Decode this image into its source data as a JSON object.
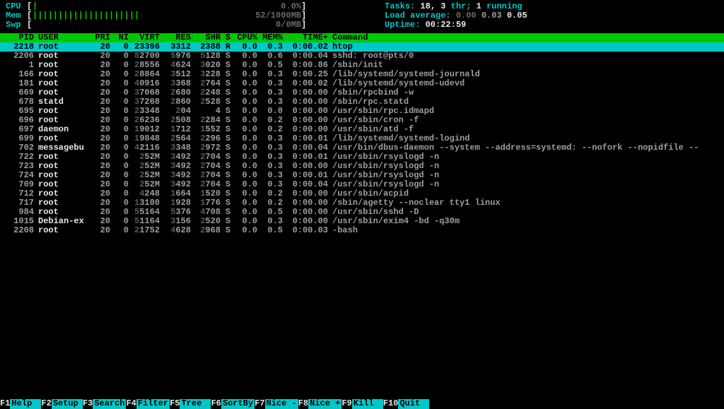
{
  "meters": {
    "cpu": {
      "label": "CPU",
      "bar_chars": "|",
      "value": "0.0%"
    },
    "mem": {
      "label": "Mem",
      "bar_chars": "|||||||||||||||||||||",
      "value": "52/1000MB"
    },
    "swp": {
      "label": "Swp",
      "bar_chars": "",
      "value": "0/0MB"
    }
  },
  "stats": {
    "tasks_label": "Tasks: ",
    "tasks_value": "18, 3",
    "tasks_suffix": " thr; ",
    "running_value": "1",
    "running_suffix": " running",
    "load_label": "Load average: ",
    "load_1": "0.00",
    "load_2": "0.03",
    "load_3": "0.05",
    "uptime_label": "Uptime: ",
    "uptime_value": "00:22:59"
  },
  "columns": {
    "pid": "PID",
    "user": "USER",
    "pri": "PRI",
    "ni": "NI",
    "virt": "VIRT",
    "res": "RES",
    "shr": "SHR",
    "s": "S",
    "cpu": "CPU%",
    "mem": "MEM%",
    "time": "TIME+",
    "cmd": "Command"
  },
  "processes": [
    {
      "pid": "2218",
      "user": "root",
      "pri": "20",
      "ni": "0",
      "virt": "23396",
      "res": "3312",
      "shr": "2388",
      "s": "R",
      "cpu": "0.0",
      "mem": "0.3",
      "time": "0:00.02",
      "cmd": "htop",
      "hl": true
    },
    {
      "pid": "2206",
      "user": "root",
      "pri": "20",
      "ni": "0",
      "virt": "82700",
      "res": "5976",
      "shr": "5128",
      "s": "S",
      "cpu": "0.0",
      "mem": "0.6",
      "time": "0:00.04",
      "cmd": "sshd: root@pts/0"
    },
    {
      "pid": "1",
      "user": "root",
      "pri": "20",
      "ni": "0",
      "virt": "28556",
      "res": "4624",
      "shr": "3020",
      "s": "S",
      "cpu": "0.0",
      "mem": "0.5",
      "time": "0:00.86",
      "cmd": "/sbin/init"
    },
    {
      "pid": "166",
      "user": "root",
      "pri": "20",
      "ni": "0",
      "virt": "28864",
      "res": "3512",
      "shr": "3228",
      "s": "S",
      "cpu": "0.0",
      "mem": "0.3",
      "time": "0:00.25",
      "cmd": "/lib/systemd/systemd-journald"
    },
    {
      "pid": "181",
      "user": "root",
      "pri": "20",
      "ni": "0",
      "virt": "40916",
      "res": "3368",
      "shr": "2764",
      "s": "S",
      "cpu": "0.0",
      "mem": "0.3",
      "time": "0:00.02",
      "cmd": "/lib/systemd/systemd-udevd"
    },
    {
      "pid": "669",
      "user": "root",
      "pri": "20",
      "ni": "0",
      "virt": "37068",
      "res": "2680",
      "shr": "2248",
      "s": "S",
      "cpu": "0.0",
      "mem": "0.3",
      "time": "0:00.00",
      "cmd": "/sbin/rpcbind -w"
    },
    {
      "pid": "678",
      "user": "statd",
      "pri": "20",
      "ni": "0",
      "virt": "37268",
      "res": "2860",
      "shr": "2528",
      "s": "S",
      "cpu": "0.0",
      "mem": "0.3",
      "time": "0:00.00",
      "cmd": "/sbin/rpc.statd"
    },
    {
      "pid": "695",
      "user": "root",
      "pri": "20",
      "ni": "0",
      "virt": "23348",
      "res": "204",
      "shr": "4",
      "s": "S",
      "cpu": "0.0",
      "mem": "0.0",
      "time": "0:00.00",
      "cmd": "/usr/sbin/rpc.idmapd"
    },
    {
      "pid": "696",
      "user": "root",
      "pri": "20",
      "ni": "0",
      "virt": "26236",
      "res": "2508",
      "shr": "2284",
      "s": "S",
      "cpu": "0.0",
      "mem": "0.2",
      "time": "0:00.00",
      "cmd": "/usr/sbin/cron -f"
    },
    {
      "pid": "697",
      "user": "daemon",
      "pri": "20",
      "ni": "0",
      "virt": "19012",
      "res": "1712",
      "shr": "1552",
      "s": "S",
      "cpu": "0.0",
      "mem": "0.2",
      "time": "0:00.00",
      "cmd": "/usr/sbin/atd -f"
    },
    {
      "pid": "699",
      "user": "root",
      "pri": "20",
      "ni": "0",
      "virt": "19848",
      "res": "2564",
      "shr": "2296",
      "s": "S",
      "cpu": "0.0",
      "mem": "0.3",
      "time": "0:00.01",
      "cmd": "/lib/systemd/systemd-logind"
    },
    {
      "pid": "702",
      "user": "messagebu",
      "pri": "20",
      "ni": "0",
      "virt": "42116",
      "res": "3348",
      "shr": "2972",
      "s": "S",
      "cpu": "0.0",
      "mem": "0.3",
      "time": "0:00.04",
      "cmd": "/usr/bin/dbus-daemon --system --address=systemd: --nofork --nopidfile --"
    },
    {
      "pid": "722",
      "user": "root",
      "pri": "20",
      "ni": "0",
      "virt": "252M",
      "res": "3492",
      "shr": "2704",
      "s": "S",
      "cpu": "0.0",
      "mem": "0.3",
      "time": "0:00.01",
      "cmd": "/usr/sbin/rsyslogd -n"
    },
    {
      "pid": "723",
      "user": "root",
      "pri": "20",
      "ni": "0",
      "virt": "252M",
      "res": "3492",
      "shr": "2704",
      "s": "S",
      "cpu": "0.0",
      "mem": "0.3",
      "time": "0:00.00",
      "cmd": "/usr/sbin/rsyslogd -n"
    },
    {
      "pid": "724",
      "user": "root",
      "pri": "20",
      "ni": "0",
      "virt": "252M",
      "res": "3492",
      "shr": "2704",
      "s": "S",
      "cpu": "0.0",
      "mem": "0.3",
      "time": "0:00.01",
      "cmd": "/usr/sbin/rsyslogd -n"
    },
    {
      "pid": "709",
      "user": "root",
      "pri": "20",
      "ni": "0",
      "virt": "252M",
      "res": "3492",
      "shr": "2704",
      "s": "S",
      "cpu": "0.0",
      "mem": "0.3",
      "time": "0:00.04",
      "cmd": "/usr/sbin/rsyslogd -n"
    },
    {
      "pid": "712",
      "user": "root",
      "pri": "20",
      "ni": "0",
      "virt": "4248",
      "res": "1664",
      "shr": "1520",
      "s": "S",
      "cpu": "0.0",
      "mem": "0.2",
      "time": "0:00.00",
      "cmd": "/usr/sbin/acpid"
    },
    {
      "pid": "717",
      "user": "root",
      "pri": "20",
      "ni": "0",
      "virt": "13180",
      "res": "1928",
      "shr": "1776",
      "s": "S",
      "cpu": "0.0",
      "mem": "0.2",
      "time": "0:00.00",
      "cmd": "/sbin/agetty --noclear tty1 linux"
    },
    {
      "pid": "984",
      "user": "root",
      "pri": "20",
      "ni": "0",
      "virt": "55164",
      "res": "5376",
      "shr": "4708",
      "s": "S",
      "cpu": "0.0",
      "mem": "0.5",
      "time": "0:00.00",
      "cmd": "/usr/sbin/sshd -D"
    },
    {
      "pid": "1015",
      "user": "Debian-ex",
      "pri": "20",
      "ni": "0",
      "virt": "51164",
      "res": "3156",
      "shr": "2520",
      "s": "S",
      "cpu": "0.0",
      "mem": "0.3",
      "time": "0:00.00",
      "cmd": "/usr/sbin/exim4 -bd -q30m"
    },
    {
      "pid": "2208",
      "user": "root",
      "pri": "20",
      "ni": "0",
      "virt": "21752",
      "res": "4628",
      "shr": "2968",
      "s": "S",
      "cpu": "0.0",
      "mem": "0.5",
      "time": "0:00.03",
      "cmd": "-bash"
    }
  ],
  "fkeys": [
    {
      "k": "F1",
      "l": "Help  "
    },
    {
      "k": "F2",
      "l": "Setup "
    },
    {
      "k": "F3",
      "l": "Search"
    },
    {
      "k": "F4",
      "l": "Filter"
    },
    {
      "k": "F5",
      "l": "Tree  "
    },
    {
      "k": "F6",
      "l": "SortBy"
    },
    {
      "k": "F7",
      "l": "Nice -"
    },
    {
      "k": "F8",
      "l": "Nice +"
    },
    {
      "k": "F9",
      "l": "Kill  "
    },
    {
      "k": "F10",
      "l": "Quit  "
    }
  ]
}
